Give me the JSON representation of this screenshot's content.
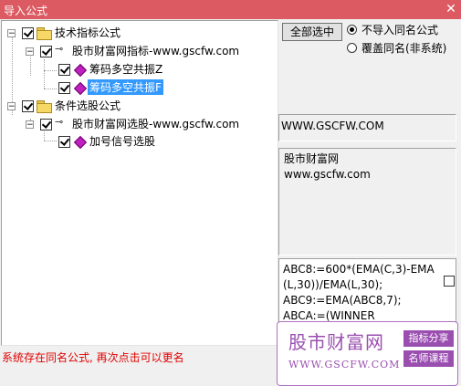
{
  "window": {
    "title": "导入公式",
    "close_glyph": "✕"
  },
  "tree": {
    "group1": {
      "label": "技术指标公式",
      "site": "股市财富网指标-www.gscfw.com",
      "items": [
        "筹码多空共振Z",
        "筹码多空共振F"
      ]
    },
    "group2": {
      "label": "条件选股公式",
      "site": "股市财富网选股-www.gscfw.com",
      "items": [
        "加号信号选股"
      ]
    }
  },
  "buttons": {
    "select_all": "全部选中"
  },
  "options": {
    "no_import_same_name": "不导入同名公式",
    "overwrite_same_name": "覆盖同名(非系统)"
  },
  "url_box": "WWW.GSCFW.COM",
  "description": {
    "line1": "股市财富网",
    "line2": "www.gscfw.com"
  },
  "code": {
    "line1": "ABC8:=600*(EMA(C,3)-EMA",
    "line2": "(L,30))/EMA(L,30);",
    "line3": "ABC9:=EMA(ABC8,7);",
    "line4": "ABCA:=(WINNER"
  },
  "status": "系统存在同名公式, 再次点击可以更名",
  "watermark": {
    "title": "股市财富网",
    "url": "WWW.GSCFW.COM",
    "tag1": "指标分享",
    "tag2": "名师课程"
  }
}
